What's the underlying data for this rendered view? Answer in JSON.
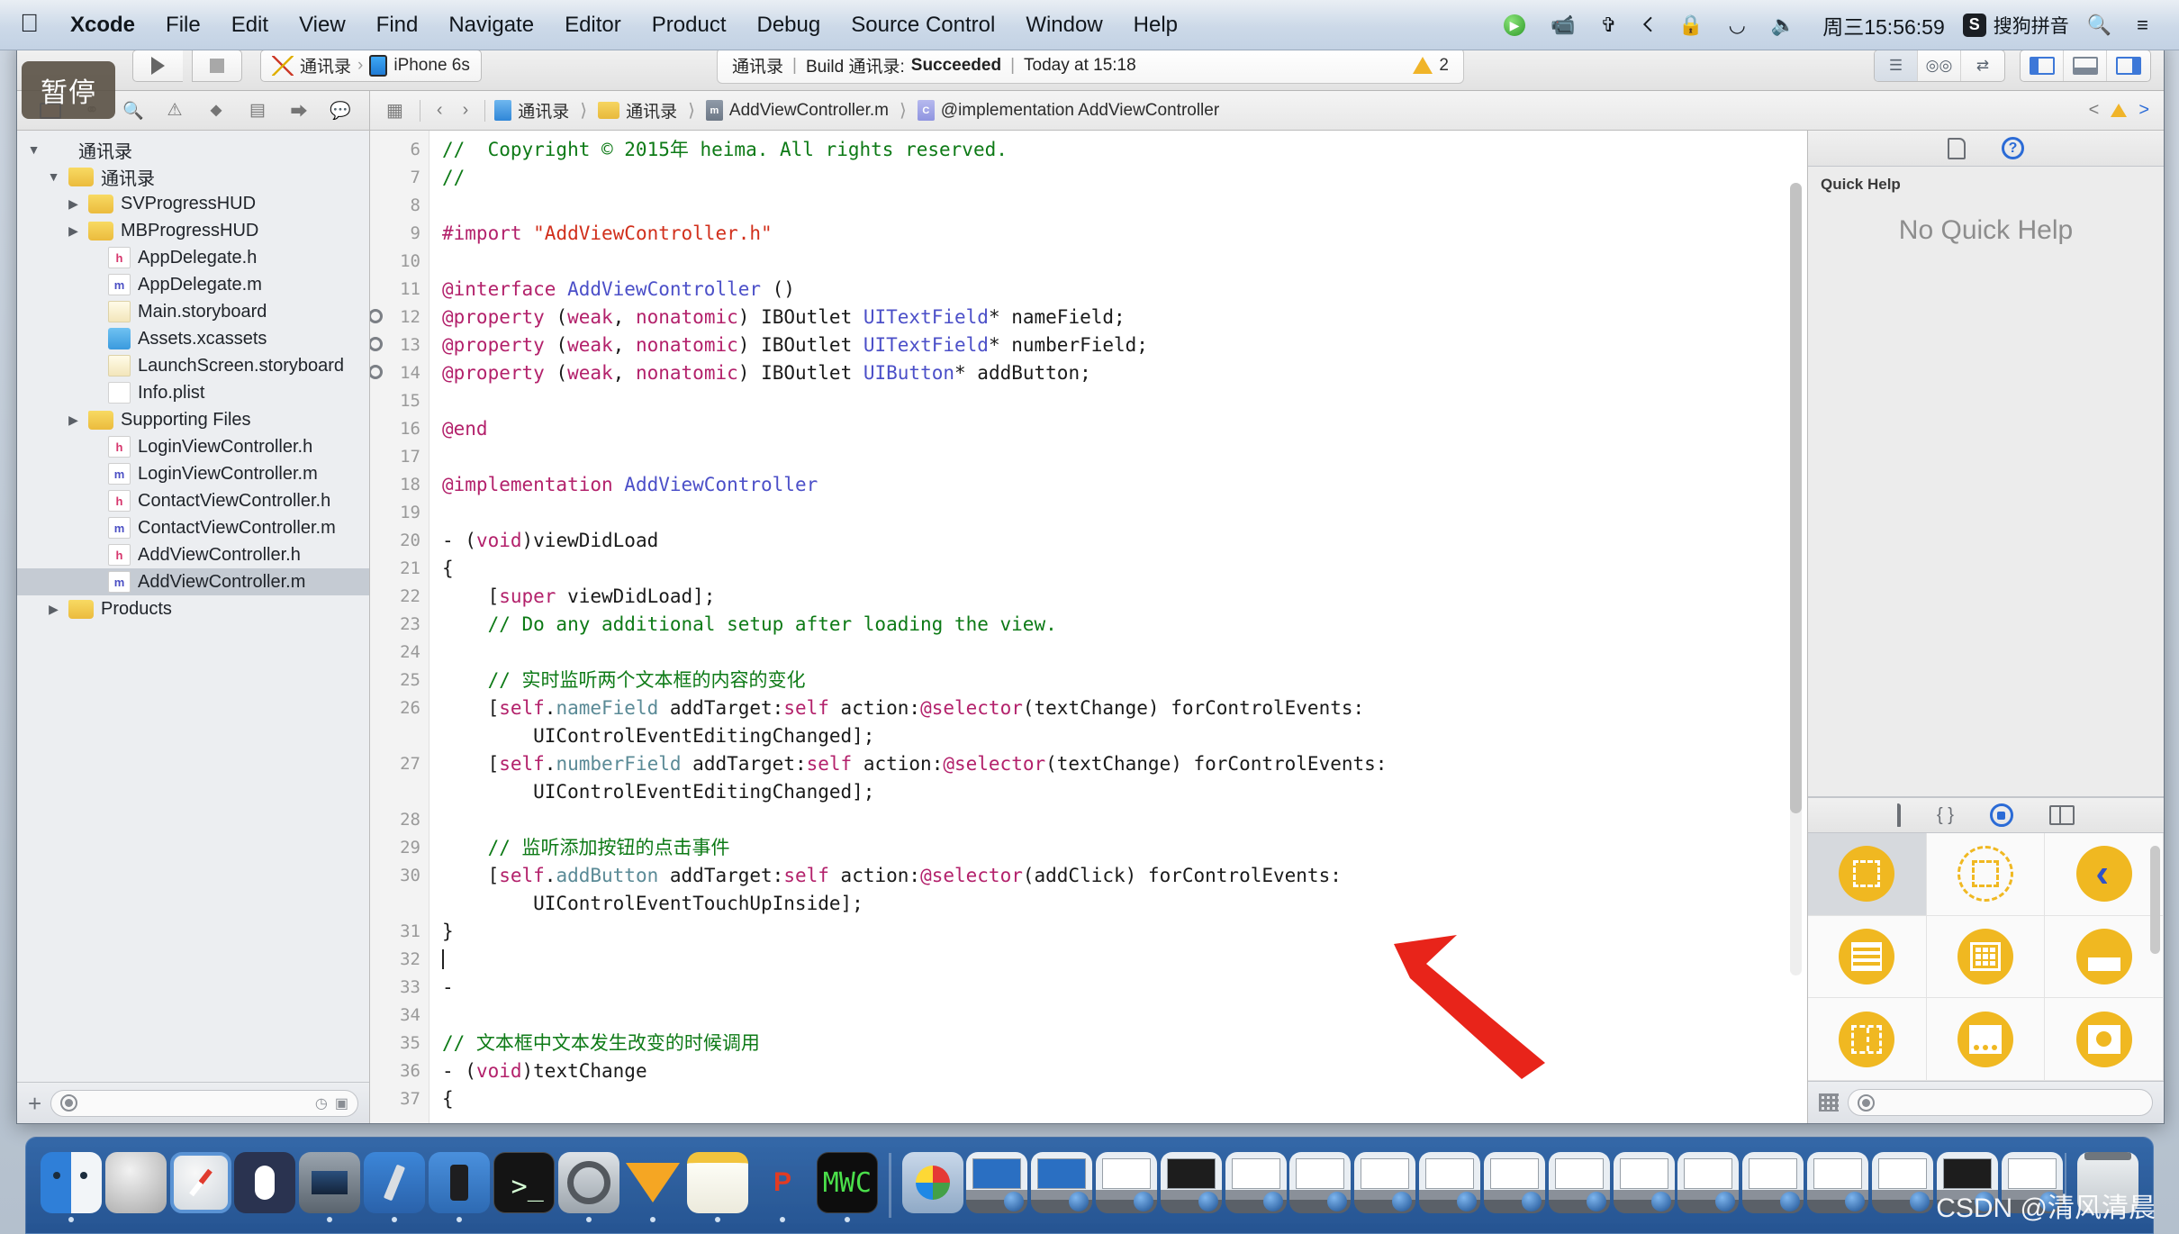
{
  "menubar": {
    "apple_icon": "apple-icon",
    "items": [
      {
        "label": "Xcode",
        "bold": true
      },
      {
        "label": "File",
        "bold": false
      },
      {
        "label": "Edit",
        "bold": false
      },
      {
        "label": "View",
        "bold": false
      },
      {
        "label": "Find",
        "bold": false
      },
      {
        "label": "Navigate",
        "bold": false
      },
      {
        "label": "Editor",
        "bold": false
      },
      {
        "label": "Product",
        "bold": false
      },
      {
        "label": "Debug",
        "bold": false
      },
      {
        "label": "Source Control",
        "bold": false
      },
      {
        "label": "Window",
        "bold": false
      },
      {
        "label": "Help",
        "bold": false
      }
    ],
    "status_icons": [
      "screen-record-icon",
      "airdrop-icon",
      "bluetooth-icon",
      "lock-icon",
      "wifi-icon",
      "volume-icon"
    ],
    "clock": "周三15:56:59",
    "ime_badge": "S",
    "ime_label": "搜狗拼音",
    "search_icon": "search-icon",
    "notification_icon": "notification-center-icon"
  },
  "toolbar": {
    "run_label": "run-button",
    "stop_label": "stop-button",
    "scheme_target": "通讯录",
    "scheme_destination": "iPhone 6s",
    "status": {
      "project": "通讯录",
      "action": "Build 通讯录:",
      "result": "Succeeded",
      "time": "Today at 15:18",
      "issue_count": "2"
    },
    "editor_modes": [
      "standard-editor",
      "assistant-editor",
      "version-editor"
    ],
    "view_toggles": [
      "navigator-toggle",
      "debug-area-toggle",
      "utilities-toggle"
    ]
  },
  "pause_badge": "暂停",
  "navigator": {
    "tabs": [
      "project-navigator",
      "symbol-navigator",
      "find-navigator",
      "issue-navigator",
      "test-navigator",
      "debug-navigator",
      "breakpoint-navigator",
      "report-navigator"
    ],
    "filter_placeholder": "",
    "tree": [
      {
        "label": "通讯录",
        "indent": 0,
        "icon": "project",
        "twisty": "open"
      },
      {
        "label": "通讯录",
        "indent": 1,
        "icon": "folder",
        "twisty": "open"
      },
      {
        "label": "SVProgressHUD",
        "indent": 2,
        "icon": "folder",
        "twisty": "closed"
      },
      {
        "label": "MBProgressHUD",
        "indent": 2,
        "icon": "folder",
        "twisty": "closed"
      },
      {
        "label": "AppDelegate.h",
        "indent": 3,
        "icon": "h",
        "twisty": ""
      },
      {
        "label": "AppDelegate.m",
        "indent": 3,
        "icon": "m",
        "twisty": ""
      },
      {
        "label": "Main.storyboard",
        "indent": 3,
        "icon": "sb",
        "twisty": ""
      },
      {
        "label": "Assets.xcassets",
        "indent": 3,
        "icon": "xc",
        "twisty": ""
      },
      {
        "label": "LaunchScreen.storyboard",
        "indent": 3,
        "icon": "sb",
        "twisty": ""
      },
      {
        "label": "Info.plist",
        "indent": 3,
        "icon": "plist",
        "twisty": ""
      },
      {
        "label": "Supporting Files",
        "indent": 2,
        "icon": "folder",
        "twisty": "closed"
      },
      {
        "label": "LoginViewController.h",
        "indent": 3,
        "icon": "h",
        "twisty": ""
      },
      {
        "label": "LoginViewController.m",
        "indent": 3,
        "icon": "m",
        "twisty": ""
      },
      {
        "label": "ContactViewController.h",
        "indent": 3,
        "icon": "h",
        "twisty": ""
      },
      {
        "label": "ContactViewController.m",
        "indent": 3,
        "icon": "m",
        "twisty": ""
      },
      {
        "label": "AddViewController.h",
        "indent": 3,
        "icon": "h",
        "twisty": ""
      },
      {
        "label": "AddViewController.m",
        "indent": 3,
        "icon": "m",
        "twisty": "",
        "selected": true
      },
      {
        "label": "Products",
        "indent": 1,
        "icon": "folder",
        "twisty": "closed"
      }
    ]
  },
  "jumpbar": {
    "back_icon": "chevron-left-icon",
    "forward_icon": "chevron-right-icon",
    "related_icon": "related-files-icon",
    "crumbs": [
      {
        "label": "通讯录",
        "icon": "proj"
      },
      {
        "label": "通讯录",
        "icon": "folder"
      },
      {
        "label": "AddViewController.m",
        "icon": "m"
      },
      {
        "label": "@implementation AddViewController",
        "icon": "c"
      }
    ],
    "issue_prev": "<",
    "issue_next": ">"
  },
  "editor": {
    "lines": [
      {
        "n": "6",
        "bp": false,
        "tokens": [
          {
            "t": "//  Copyright © 2015年 heima. All rights reserved.",
            "c": "cm"
          }
        ]
      },
      {
        "n": "7",
        "bp": false,
        "tokens": [
          {
            "t": "//",
            "c": "cm"
          }
        ]
      },
      {
        "n": "8",
        "bp": false,
        "tokens": []
      },
      {
        "n": "9",
        "bp": false,
        "tokens": [
          {
            "t": "#import ",
            "c": "pp"
          },
          {
            "t": "\"AddViewController.h\"",
            "c": "str"
          }
        ]
      },
      {
        "n": "10",
        "bp": false,
        "tokens": []
      },
      {
        "n": "11",
        "bp": false,
        "tokens": [
          {
            "t": "@interface ",
            "c": "kw"
          },
          {
            "t": "AddViewController",
            "c": "typ"
          },
          {
            "t": " ()",
            "c": "plain"
          }
        ]
      },
      {
        "n": "12",
        "bp": true,
        "tokens": [
          {
            "t": "@property ",
            "c": "kw"
          },
          {
            "t": "(",
            "c": "plain"
          },
          {
            "t": "weak",
            "c": "kw"
          },
          {
            "t": ", ",
            "c": "plain"
          },
          {
            "t": "nonatomic",
            "c": "kw"
          },
          {
            "t": ") ",
            "c": "plain"
          },
          {
            "t": "IBOutlet ",
            "c": "plain"
          },
          {
            "t": "UITextField",
            "c": "typ"
          },
          {
            "t": "* nameField;",
            "c": "plain"
          }
        ]
      },
      {
        "n": "13",
        "bp": true,
        "tokens": [
          {
            "t": "@property ",
            "c": "kw"
          },
          {
            "t": "(",
            "c": "plain"
          },
          {
            "t": "weak",
            "c": "kw"
          },
          {
            "t": ", ",
            "c": "plain"
          },
          {
            "t": "nonatomic",
            "c": "kw"
          },
          {
            "t": ") ",
            "c": "plain"
          },
          {
            "t": "IBOutlet ",
            "c": "plain"
          },
          {
            "t": "UITextField",
            "c": "typ"
          },
          {
            "t": "* numberField;",
            "c": "plain"
          }
        ]
      },
      {
        "n": "14",
        "bp": true,
        "tokens": [
          {
            "t": "@property ",
            "c": "kw"
          },
          {
            "t": "(",
            "c": "plain"
          },
          {
            "t": "weak",
            "c": "kw"
          },
          {
            "t": ", ",
            "c": "plain"
          },
          {
            "t": "nonatomic",
            "c": "kw"
          },
          {
            "t": ") ",
            "c": "plain"
          },
          {
            "t": "IBOutlet ",
            "c": "plain"
          },
          {
            "t": "UIButton",
            "c": "typ"
          },
          {
            "t": "* addButton;",
            "c": "plain"
          }
        ]
      },
      {
        "n": "15",
        "bp": false,
        "tokens": []
      },
      {
        "n": "16",
        "bp": false,
        "tokens": [
          {
            "t": "@end",
            "c": "kw"
          }
        ]
      },
      {
        "n": "17",
        "bp": false,
        "tokens": []
      },
      {
        "n": "18",
        "bp": false,
        "tokens": [
          {
            "t": "@implementation ",
            "c": "kw"
          },
          {
            "t": "AddViewController",
            "c": "typ"
          }
        ]
      },
      {
        "n": "19",
        "bp": false,
        "tokens": []
      },
      {
        "n": "20",
        "bp": false,
        "tokens": [
          {
            "t": "- (",
            "c": "plain"
          },
          {
            "t": "void",
            "c": "kw"
          },
          {
            "t": ")viewDidLoad",
            "c": "plain"
          }
        ]
      },
      {
        "n": "21",
        "bp": false,
        "tokens": [
          {
            "t": "{",
            "c": "plain"
          }
        ]
      },
      {
        "n": "22",
        "bp": false,
        "tokens": [
          {
            "t": "    [",
            "c": "plain"
          },
          {
            "t": "super",
            "c": "kw"
          },
          {
            "t": " viewDidLoad];",
            "c": "plain"
          }
        ]
      },
      {
        "n": "23",
        "bp": false,
        "tokens": [
          {
            "t": "    // Do any additional setup after loading the view.",
            "c": "cm"
          }
        ]
      },
      {
        "n": "24",
        "bp": false,
        "tokens": []
      },
      {
        "n": "25",
        "bp": false,
        "tokens": [
          {
            "t": "    // 实时监听两个文本框的内容的变化",
            "c": "cm"
          }
        ]
      },
      {
        "n": "26",
        "bp": false,
        "tokens": [
          {
            "t": "    [",
            "c": "plain"
          },
          {
            "t": "self",
            "c": "kw"
          },
          {
            "t": ".",
            "c": "plain"
          },
          {
            "t": "nameField",
            "c": "prop"
          },
          {
            "t": " addTarget:",
            "c": "plain"
          },
          {
            "t": "self",
            "c": "kw"
          },
          {
            "t": " action:",
            "c": "plain"
          },
          {
            "t": "@selector",
            "c": "kw"
          },
          {
            "t": "(textChange) forControlEvents:",
            "c": "plain"
          }
        ]
      },
      {
        "n": "",
        "bp": false,
        "tokens": [
          {
            "t": "        UIControlEventEditingChanged];",
            "c": "plain"
          }
        ]
      },
      {
        "n": "27",
        "bp": false,
        "tokens": [
          {
            "t": "    [",
            "c": "plain"
          },
          {
            "t": "self",
            "c": "kw"
          },
          {
            "t": ".",
            "c": "plain"
          },
          {
            "t": "numberField",
            "c": "prop"
          },
          {
            "t": " addTarget:",
            "c": "plain"
          },
          {
            "t": "self",
            "c": "kw"
          },
          {
            "t": " action:",
            "c": "plain"
          },
          {
            "t": "@selector",
            "c": "kw"
          },
          {
            "t": "(textChange) forControlEvents:",
            "c": "plain"
          }
        ]
      },
      {
        "n": "",
        "bp": false,
        "tokens": [
          {
            "t": "        UIControlEventEditingChanged];",
            "c": "plain"
          }
        ]
      },
      {
        "n": "28",
        "bp": false,
        "tokens": []
      },
      {
        "n": "29",
        "bp": false,
        "tokens": [
          {
            "t": "    // 监听添加按钮的点击事件",
            "c": "cm"
          }
        ]
      },
      {
        "n": "30",
        "bp": false,
        "tokens": [
          {
            "t": "    [",
            "c": "plain"
          },
          {
            "t": "self",
            "c": "kw"
          },
          {
            "t": ".",
            "c": "plain"
          },
          {
            "t": "addButton",
            "c": "prop"
          },
          {
            "t": " addTarget:",
            "c": "plain"
          },
          {
            "t": "self",
            "c": "kw"
          },
          {
            "t": " action:",
            "c": "plain"
          },
          {
            "t": "@selector",
            "c": "kw"
          },
          {
            "t": "(addClick) forControlEvents:",
            "c": "plain"
          }
        ]
      },
      {
        "n": "",
        "bp": false,
        "tokens": [
          {
            "t": "        UIControlEventTouchUpInside];",
            "c": "plain"
          }
        ]
      },
      {
        "n": "31",
        "bp": false,
        "tokens": [
          {
            "t": "}",
            "c": "plain"
          }
        ]
      },
      {
        "n": "32",
        "bp": false,
        "tokens": [],
        "caret": true
      },
      {
        "n": "33",
        "bp": false,
        "tokens": [
          {
            "t": "-",
            "c": "plain"
          }
        ]
      },
      {
        "n": "34",
        "bp": false,
        "tokens": []
      },
      {
        "n": "35",
        "bp": false,
        "tokens": [
          {
            "t": "// 文本框中文本发生改变的时候调用",
            "c": "cm"
          }
        ]
      },
      {
        "n": "36",
        "bp": false,
        "tokens": [
          {
            "t": "- (",
            "c": "plain"
          },
          {
            "t": "void",
            "c": "kw"
          },
          {
            "t": ")textChange",
            "c": "plain"
          }
        ]
      },
      {
        "n": "37",
        "bp": false,
        "tokens": [
          {
            "t": "{",
            "c": "plain"
          }
        ]
      }
    ]
  },
  "utilities": {
    "tabs": [
      "file-inspector",
      "quick-help-inspector"
    ],
    "quick_help_title": "Quick Help",
    "quick_help_empty": "No Quick Help",
    "library_tabs": [
      "file-template-library",
      "code-snippet-library",
      "object-library",
      "media-library"
    ],
    "objects": [
      {
        "name": "view-object",
        "selected": true
      },
      {
        "name": "view-controller-object",
        "selected": false
      },
      {
        "name": "navigation-controller-object",
        "selected": false
      },
      {
        "name": "table-view-controller-object",
        "selected": false
      },
      {
        "name": "collection-view-controller-object",
        "selected": false
      },
      {
        "name": "split-view-controller-object",
        "selected": false
      },
      {
        "name": "page-view-controller-object",
        "selected": false
      },
      {
        "name": "tab-bar-controller-object",
        "selected": false
      },
      {
        "name": "gl-kit-view-controller-object",
        "selected": false
      }
    ],
    "filter_placeholder": ""
  },
  "dock": {
    "items": [
      {
        "name": "finder",
        "cls": "g-finder",
        "running": true,
        "label": ""
      },
      {
        "name": "launchpad",
        "cls": "g-launch",
        "running": false,
        "label": ""
      },
      {
        "name": "safari",
        "cls": "g-safari",
        "running": false,
        "label": ""
      },
      {
        "name": "mouse-app",
        "cls": "g-mouse",
        "running": false,
        "label": ""
      },
      {
        "name": "quicktime-player",
        "cls": "g-qt",
        "running": true,
        "label": ""
      },
      {
        "name": "xcode",
        "cls": "g-xcode",
        "running": true,
        "label": ""
      },
      {
        "name": "ios-simulator",
        "cls": "g-xcode2",
        "running": true,
        "label": ""
      },
      {
        "name": "terminal",
        "cls": "g-term",
        "running": false,
        "label": ">_"
      },
      {
        "name": "system-preferences",
        "cls": "g-sysprefs",
        "running": true,
        "label": ""
      },
      {
        "name": "sketch",
        "cls": "g-sketch",
        "running": true,
        "label": ""
      },
      {
        "name": "notes",
        "cls": "g-notes",
        "running": true,
        "label": ""
      },
      {
        "name": "p-app",
        "cls": "g-pcolor",
        "running": true,
        "label": "P"
      },
      {
        "name": "terminal-alt",
        "cls": "g-term2",
        "running": true,
        "label": "MWC"
      }
    ],
    "minimized": [
      {
        "name": "minimized-window",
        "scr": "blue"
      },
      {
        "name": "minimized-window",
        "scr": "blue"
      },
      {
        "name": "minimized-window",
        "scr": ""
      },
      {
        "name": "minimized-window",
        "scr": "dark"
      },
      {
        "name": "minimized-window",
        "scr": ""
      },
      {
        "name": "minimized-window",
        "scr": ""
      },
      {
        "name": "minimized-window",
        "scr": ""
      },
      {
        "name": "minimized-window",
        "scr": ""
      },
      {
        "name": "minimized-window",
        "scr": ""
      },
      {
        "name": "minimized-window",
        "scr": ""
      },
      {
        "name": "minimized-window",
        "scr": ""
      },
      {
        "name": "minimized-window",
        "scr": ""
      },
      {
        "name": "minimized-window",
        "scr": ""
      },
      {
        "name": "minimized-window",
        "scr": ""
      },
      {
        "name": "minimized-window",
        "scr": ""
      },
      {
        "name": "minimized-window",
        "scr": "dark"
      },
      {
        "name": "minimized-window",
        "scr": ""
      }
    ],
    "trash": "trash",
    "media_app": "media-player"
  },
  "watermark": "CSDN @清风清晨",
  "colors": {
    "accent_blue": "#2b6bd6",
    "comment_green": "#0d7a16",
    "keyword_pink": "#b3216b",
    "string_red": "#d12f1b",
    "type_blue": "#4b4fc8",
    "library_yellow": "#f0b821",
    "arrow_red": "#e8241a",
    "dock_blue": "#2a61a5"
  }
}
